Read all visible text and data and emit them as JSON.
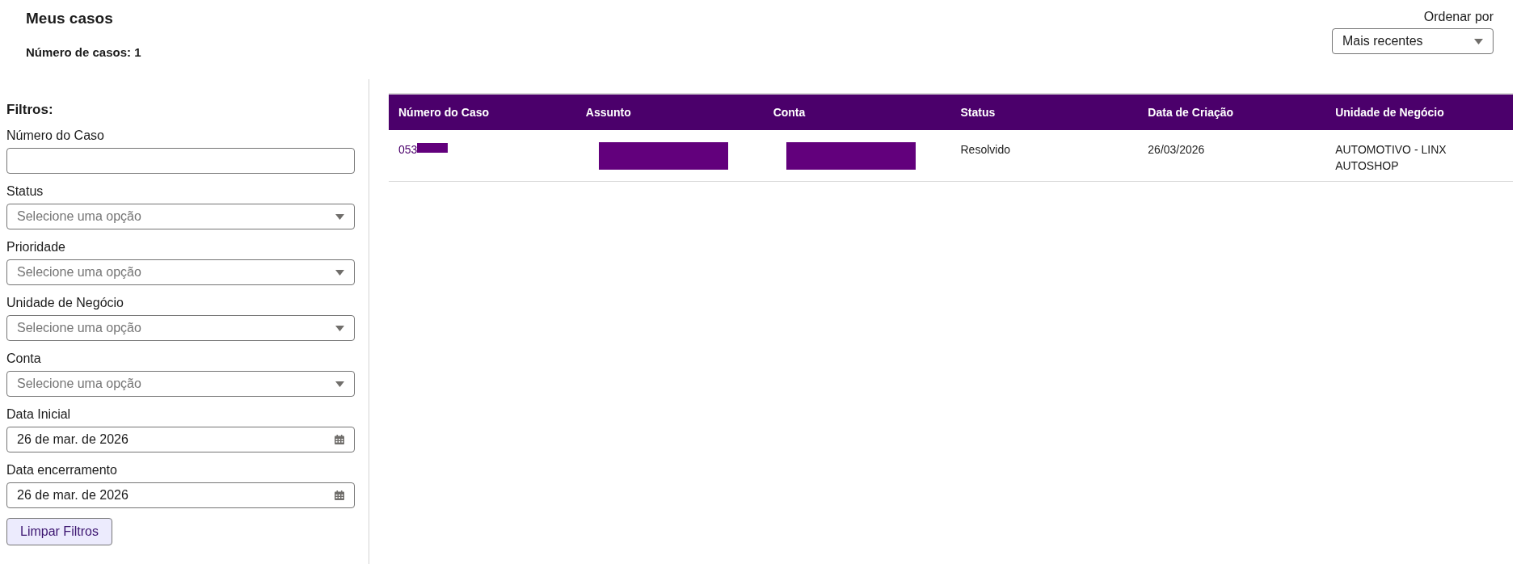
{
  "header": {
    "title": "Meus casos",
    "case_count": "Número de casos: 1"
  },
  "sort": {
    "label": "Ordenar por",
    "value": "Mais recentes"
  },
  "filters": {
    "title": "Filtros:",
    "fields": [
      {
        "kind": "text",
        "label": "Número do Caso"
      },
      {
        "kind": "select",
        "label": "Status",
        "placeholder": "Selecione uma opção"
      },
      {
        "kind": "select",
        "label": "Prioridade",
        "placeholder": "Selecione uma opção"
      },
      {
        "kind": "select",
        "label": "Unidade de Negócio",
        "placeholder": "Selecione uma opção"
      },
      {
        "kind": "select",
        "label": "Conta",
        "placeholder": "Selecione uma opção"
      },
      {
        "kind": "date",
        "label": "Data Inicial",
        "value": "26 de mar. de 2026"
      },
      {
        "kind": "date",
        "label": "Data encerramento",
        "value": "26 de mar. de 2026"
      }
    ],
    "clear_button": "Limpar Filtros"
  },
  "table": {
    "columns": [
      "Número do Caso",
      "Assunto",
      "Conta",
      "Status",
      "Data de Criação",
      "Unidade de Negócio"
    ],
    "rows": [
      [
        {
          "text": "053",
          "redacted": true
        },
        {
          "redacted": true
        },
        {
          "redacted": true
        },
        {
          "text": "Resolvido",
          "redacted": false
        },
        {
          "text": "26/03/2026",
          "redacted": false
        },
        {
          "text": "AUTOMOTIVO - LINX AUTOSHOP",
          "redacted": false
        }
      ]
    ]
  }
}
